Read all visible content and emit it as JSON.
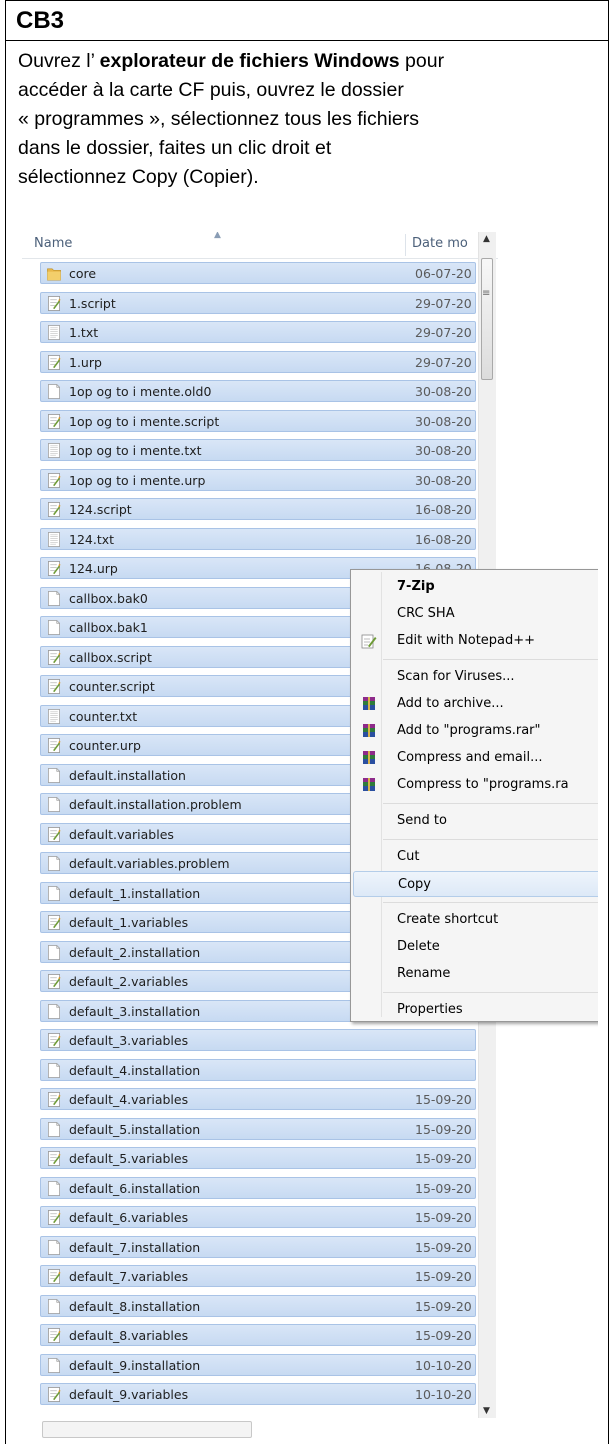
{
  "doc": {
    "title": "CB3",
    "line1_pre": "Ouvrez l’ ",
    "line1_bold": "explorateur de fichiers Windows",
    "line1_post": " pour",
    "line2": "accéder à la carte CF puis, ouvrez le dossier",
    "line3": "« programmes », sélectionnez tous les fichiers",
    "line4": "dans le dossier, faites un clic droit et",
    "line5": "sélectionnez Copy (Copier)."
  },
  "explorer": {
    "col_name": "Name",
    "col_date": "Date mo",
    "files": [
      {
        "name": "core",
        "date": "06-07-20",
        "icon": "folder-icon"
      },
      {
        "name": "1.script",
        "date": "29-07-20",
        "icon": "script-file-icon"
      },
      {
        "name": "1.txt",
        "date": "29-07-20",
        "icon": "text-file-icon"
      },
      {
        "name": "1.urp",
        "date": "29-07-20",
        "icon": "script-file-icon"
      },
      {
        "name": "1op og to i mente.old0",
        "date": "30-08-20",
        "icon": "blank-file-icon"
      },
      {
        "name": "1op og to i mente.script",
        "date": "30-08-20",
        "icon": "script-file-icon"
      },
      {
        "name": "1op og to i mente.txt",
        "date": "30-08-20",
        "icon": "text-file-icon"
      },
      {
        "name": "1op og to i mente.urp",
        "date": "30-08-20",
        "icon": "script-file-icon"
      },
      {
        "name": "124.script",
        "date": "16-08-20",
        "icon": "script-file-icon"
      },
      {
        "name": "124.txt",
        "date": "16-08-20",
        "icon": "text-file-icon"
      },
      {
        "name": "124.urp",
        "date": "16-08-20",
        "icon": "script-file-icon"
      },
      {
        "name": "callbox.bak0",
        "date": "",
        "icon": "blank-file-icon"
      },
      {
        "name": "callbox.bak1",
        "date": "",
        "icon": "blank-file-icon"
      },
      {
        "name": "callbox.script",
        "date": "",
        "icon": "script-file-icon"
      },
      {
        "name": "counter.script",
        "date": "",
        "icon": "script-file-icon"
      },
      {
        "name": "counter.txt",
        "date": "",
        "icon": "text-file-icon"
      },
      {
        "name": "counter.urp",
        "date": "",
        "icon": "script-file-icon"
      },
      {
        "name": "default.installation",
        "date": "",
        "icon": "blank-file-icon"
      },
      {
        "name": "default.installation.problem",
        "date": "",
        "icon": "blank-file-icon"
      },
      {
        "name": "default.variables",
        "date": "",
        "icon": "script-file-icon"
      },
      {
        "name": "default.variables.problem",
        "date": "",
        "icon": "blank-file-icon"
      },
      {
        "name": "default_1.installation",
        "date": "",
        "icon": "blank-file-icon"
      },
      {
        "name": "default_1.variables",
        "date": "",
        "icon": "script-file-icon"
      },
      {
        "name": "default_2.installation",
        "date": "",
        "icon": "blank-file-icon"
      },
      {
        "name": "default_2.variables",
        "date": "",
        "icon": "script-file-icon"
      },
      {
        "name": "default_3.installation",
        "date": "",
        "icon": "blank-file-icon"
      },
      {
        "name": "default_3.variables",
        "date": "",
        "icon": "script-file-icon"
      },
      {
        "name": "default_4.installation",
        "date": "",
        "icon": "blank-file-icon"
      },
      {
        "name": "default_4.variables",
        "date": "15-09-20",
        "icon": "script-file-icon"
      },
      {
        "name": "default_5.installation",
        "date": "15-09-20",
        "icon": "blank-file-icon"
      },
      {
        "name": "default_5.variables",
        "date": "15-09-20",
        "icon": "script-file-icon"
      },
      {
        "name": "default_6.installation",
        "date": "15-09-20",
        "icon": "blank-file-icon"
      },
      {
        "name": "default_6.variables",
        "date": "15-09-20",
        "icon": "script-file-icon"
      },
      {
        "name": "default_7.installation",
        "date": "15-09-20",
        "icon": "blank-file-icon"
      },
      {
        "name": "default_7.variables",
        "date": "15-09-20",
        "icon": "script-file-icon"
      },
      {
        "name": "default_8.installation",
        "date": "15-09-20",
        "icon": "blank-file-icon"
      },
      {
        "name": "default_8.variables",
        "date": "15-09-20",
        "icon": "script-file-icon"
      },
      {
        "name": "default_9.installation",
        "date": "10-10-20",
        "icon": "blank-file-icon"
      },
      {
        "name": "default_9.variables",
        "date": "10-10-20",
        "icon": "script-file-icon"
      }
    ]
  },
  "context_menu": {
    "items": [
      {
        "label": "7-Zip",
        "bold": true,
        "icon": ""
      },
      {
        "label": "CRC SHA",
        "icon": ""
      },
      {
        "label": "Edit with Notepad++",
        "icon": "notepad-plus-icon"
      },
      {
        "sep": true
      },
      {
        "label": "Scan for Viruses...",
        "icon": ""
      },
      {
        "label": "Add to archive...",
        "icon": "winrar-icon"
      },
      {
        "label": "Add to \"programs.rar\"",
        "icon": "winrar-icon"
      },
      {
        "label": "Compress and email...",
        "icon": "winrar-icon"
      },
      {
        "label": "Compress to \"programs.ra",
        "icon": "winrar-icon"
      },
      {
        "sep": true
      },
      {
        "label": "Send to",
        "icon": ""
      },
      {
        "sep": true
      },
      {
        "label": "Cut",
        "icon": ""
      },
      {
        "label": "Copy",
        "icon": "",
        "hover": true
      },
      {
        "sep": true
      },
      {
        "label": "Create shortcut",
        "icon": ""
      },
      {
        "label": "Delete",
        "icon": ""
      },
      {
        "label": "Rename",
        "icon": ""
      },
      {
        "sep": true
      },
      {
        "label": "Properties",
        "icon": ""
      }
    ]
  },
  "colors": {
    "selection": "#cfe0f5",
    "selection_border": "#a9c3e6",
    "menu_bg": "#f5f5f5"
  }
}
